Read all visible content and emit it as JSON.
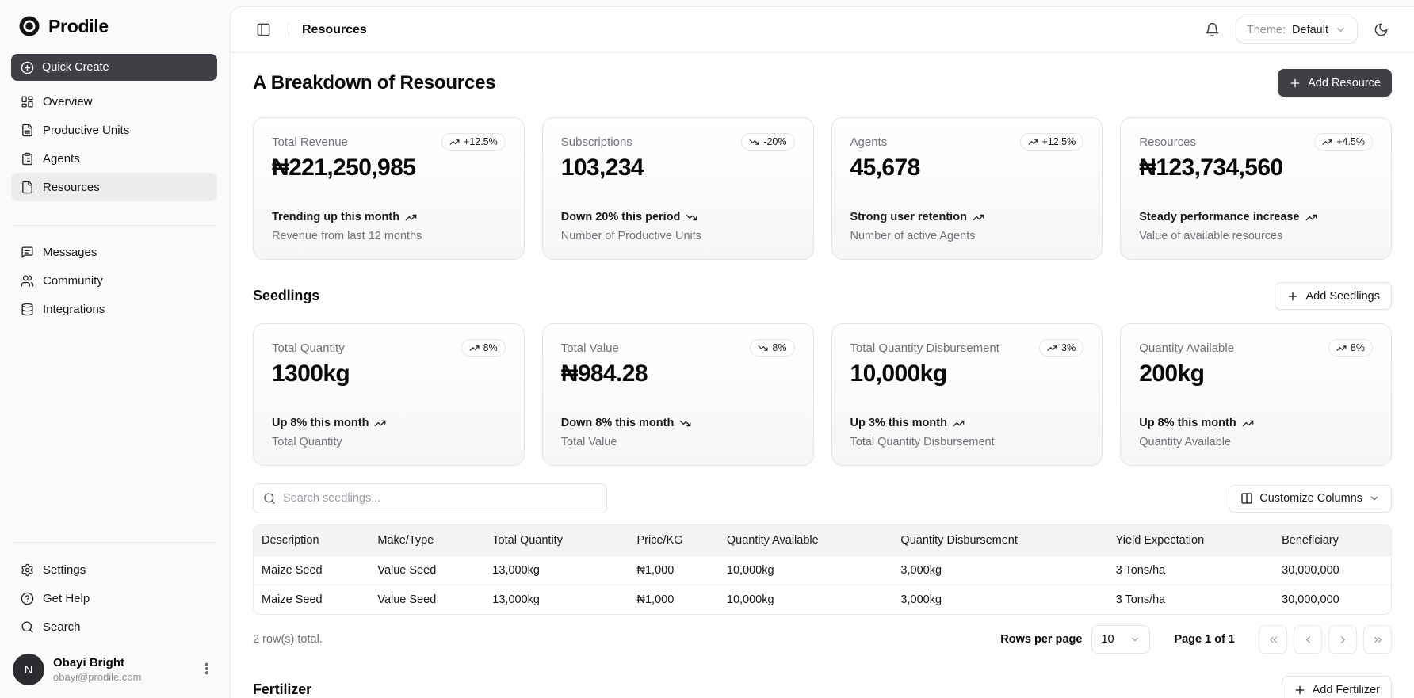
{
  "brand": {
    "name": "Prodile"
  },
  "sidebar": {
    "quick_create": "Quick Create",
    "nav_main": [
      {
        "label": "Overview"
      },
      {
        "label": "Productive Units"
      },
      {
        "label": "Agents"
      },
      {
        "label": "Resources"
      }
    ],
    "nav_secondary": [
      {
        "label": "Messages"
      },
      {
        "label": "Community"
      },
      {
        "label": "Integrations"
      }
    ],
    "nav_bottom": [
      {
        "label": "Settings"
      },
      {
        "label": "Get Help"
      },
      {
        "label": "Search"
      }
    ],
    "user": {
      "initial": "N",
      "name": "Obayi Bright",
      "email": "obayi@prodile.com"
    }
  },
  "header": {
    "title": "Resources",
    "theme_label": "Theme:",
    "theme_value": "Default"
  },
  "page": {
    "title": "A Breakdown of Resources",
    "add_resource_label": "Add Resource",
    "stats": [
      {
        "label": "Total Revenue",
        "badge": "+12.5%",
        "trend": "up",
        "value": "₦221,250,985",
        "foot1": "Trending up this month",
        "foot2": "Revenue from last 12 months"
      },
      {
        "label": "Subscriptions",
        "badge": "-20%",
        "trend": "down",
        "value": "103,234",
        "foot1": "Down 20% this period",
        "foot2": "Number of Productive Units"
      },
      {
        "label": "Agents",
        "badge": "+12.5%",
        "trend": "up",
        "value": "45,678",
        "foot1": "Strong user retention",
        "foot2": "Number of active Agents"
      },
      {
        "label": "Resources",
        "badge": "+4.5%",
        "trend": "up",
        "value": "₦123,734,560",
        "foot1": "Steady performance increase",
        "foot2": "Value of available resources"
      }
    ],
    "seedlings": {
      "title": "Seedlings",
      "add_label": "Add Seedlings",
      "cards": [
        {
          "label": "Total Quantity",
          "badge": "8%",
          "trend": "up",
          "value": "1300kg",
          "foot1": "Up 8% this month",
          "foot2": "Total Quantity"
        },
        {
          "label": "Total Value",
          "badge": "8%",
          "trend": "down",
          "value": "₦984.28",
          "foot1": "Down 8% this month",
          "foot2": "Total Value"
        },
        {
          "label": "Total Quantity Disbursement",
          "badge": "3%",
          "trend": "up",
          "value": "10,000kg",
          "foot1": "Up 3% this month",
          "foot2": "Total Quantity Disbursement"
        },
        {
          "label": "Quantity Available",
          "badge": "8%",
          "trend": "up",
          "value": "200kg",
          "foot1": "Up 8% this month",
          "foot2": "Quantity Available"
        }
      ],
      "search_placeholder": "Search seedlings...",
      "customize_label": "Customize Columns",
      "table": {
        "columns": [
          "Description",
          "Make/Type",
          "Total Quantity",
          "Price/KG",
          "Quantity Available",
          "Quantity Disbursement",
          "Yield Expectation",
          "Beneficiary"
        ],
        "rows": [
          [
            "Maize Seed",
            "Value Seed",
            "13,000kg",
            "₦1,000",
            "10,000kg",
            "3,000kg",
            "3 Tons/ha",
            "30,000,000"
          ],
          [
            "Maize Seed",
            "Value Seed",
            "13,000kg",
            "₦1,000",
            "10,000kg",
            "3,000kg",
            "3 Tons/ha",
            "30,000,000"
          ]
        ]
      },
      "footer": {
        "total": "2 row(s) total.",
        "rows_per_page_label": "Rows per page",
        "page_size": "10",
        "page_info": "Page 1 of 1"
      }
    },
    "fertilizer": {
      "title": "Fertilizer",
      "add_label": "Add Fertilizer"
    }
  }
}
